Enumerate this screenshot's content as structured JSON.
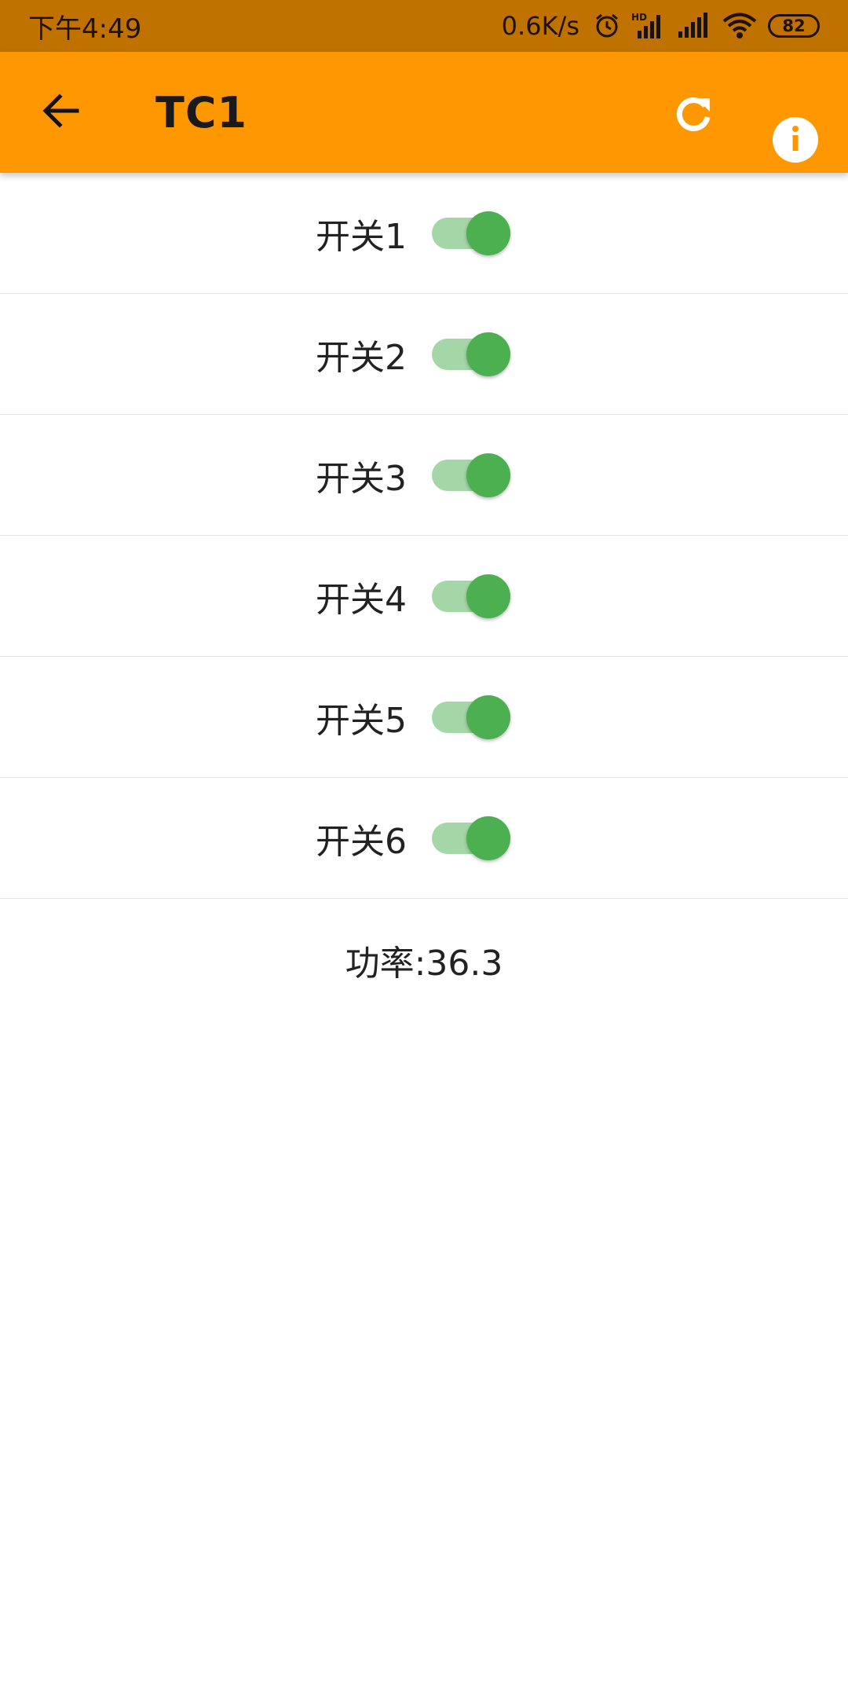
{
  "status_bar": {
    "time": "下午4:49",
    "net_speed": "0.6K/s",
    "hd_label": "HD",
    "battery": "82"
  },
  "app_bar": {
    "title": "TC1",
    "back_icon": "arrow-back-icon",
    "refresh_icon": "refresh-icon",
    "info_icon": "info-icon",
    "bar_color": "#ff9800"
  },
  "switches": [
    {
      "label": "开关1",
      "on": true
    },
    {
      "label": "开关2",
      "on": true
    },
    {
      "label": "开关3",
      "on": true
    },
    {
      "label": "开关4",
      "on": true
    },
    {
      "label": "开关5",
      "on": true
    },
    {
      "label": "开关6",
      "on": true
    }
  ],
  "power": {
    "text": "功率:36.3"
  },
  "colors": {
    "accent": "#4caf50",
    "track": "#a5d6a7"
  }
}
